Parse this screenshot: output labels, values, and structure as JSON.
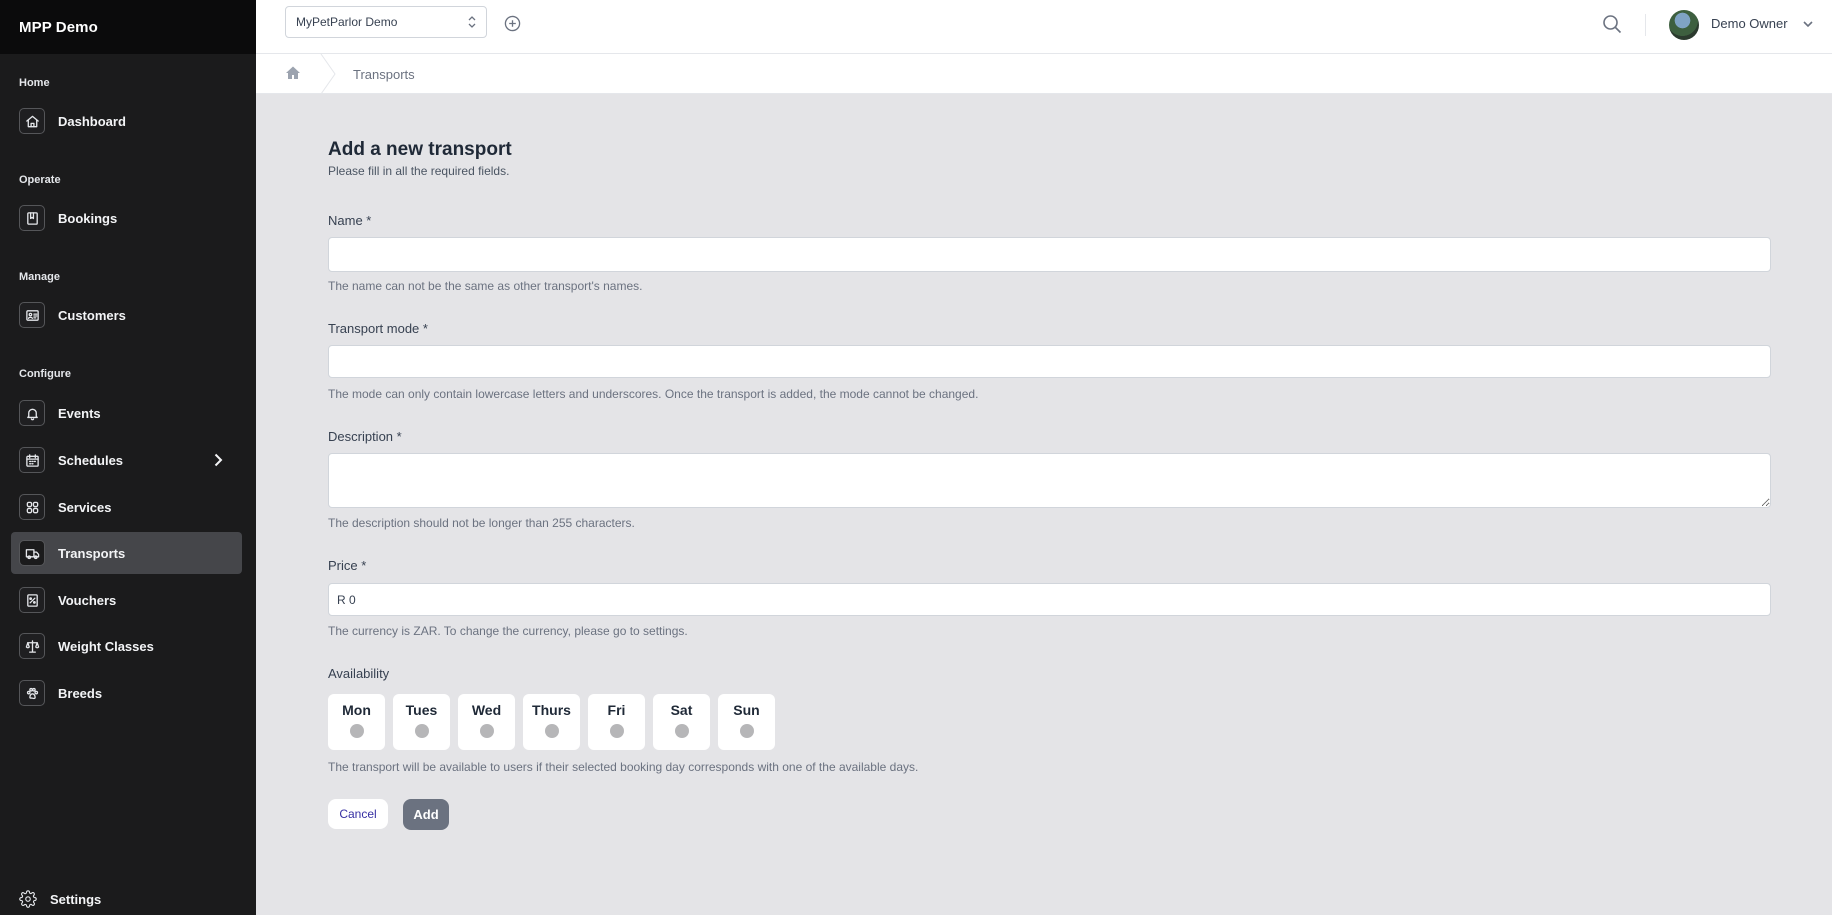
{
  "app": {
    "title": "MPP Demo"
  },
  "sidebar": {
    "sections": [
      {
        "label": "Home"
      },
      {
        "label": "Operate"
      },
      {
        "label": "Manage"
      },
      {
        "label": "Configure"
      }
    ],
    "items": [
      {
        "label": "Dashboard",
        "icon": "home-icon"
      },
      {
        "label": "Bookings",
        "icon": "book-icon"
      },
      {
        "label": "Customers",
        "icon": "id-card-icon"
      },
      {
        "label": "Events",
        "icon": "bell-icon"
      },
      {
        "label": "Schedules",
        "icon": "calendar-icon"
      },
      {
        "label": "Services",
        "icon": "grid-icon"
      },
      {
        "label": "Transports",
        "icon": "truck-icon",
        "active": true
      },
      {
        "label": "Vouchers",
        "icon": "voucher-icon"
      },
      {
        "label": "Weight Classes",
        "icon": "scale-icon"
      },
      {
        "label": "Breeds",
        "icon": "paw-icon"
      }
    ],
    "settings_label": "Settings"
  },
  "topbar": {
    "org_select_value": "MyPetParlor Demo",
    "user_name": "Demo Owner"
  },
  "breadcrumb": {
    "current": "Transports"
  },
  "form": {
    "title": "Add a new transport",
    "subtitle": "Please fill in all the required fields.",
    "name": {
      "label": "Name *",
      "value": "",
      "help": "The name can not be the same as other transport's names."
    },
    "mode": {
      "label": "Transport mode *",
      "value": "",
      "help": "The mode can only contain lowercase letters and underscores. Once the transport is added, the mode cannot be changed."
    },
    "description": {
      "label": "Description *",
      "value": "",
      "help": "The description should not be longer than 255 characters."
    },
    "price": {
      "label": "Price *",
      "value": "R 0",
      "help": "The currency is ZAR. To change the currency, please go to settings."
    },
    "availability": {
      "label": "Availability",
      "days": [
        {
          "name": "Mon",
          "enabled": false
        },
        {
          "name": "Tues",
          "enabled": false
        },
        {
          "name": "Wed",
          "enabled": false
        },
        {
          "name": "Thurs",
          "enabled": false
        },
        {
          "name": "Fri",
          "enabled": false
        },
        {
          "name": "Sat",
          "enabled": false
        },
        {
          "name": "Sun",
          "enabled": false
        }
      ],
      "help": "The transport will be available to users if their selected booking day corresponds with one of the available days."
    },
    "cancel_label": "Cancel",
    "add_label": "Add"
  },
  "colors": {
    "sidebar_bg": "#1b1b1c",
    "sidebar_active": "#45464a",
    "content_bg": "#e4e4e7",
    "add_button": "#6b7280",
    "cancel_text": "#3730a3"
  }
}
